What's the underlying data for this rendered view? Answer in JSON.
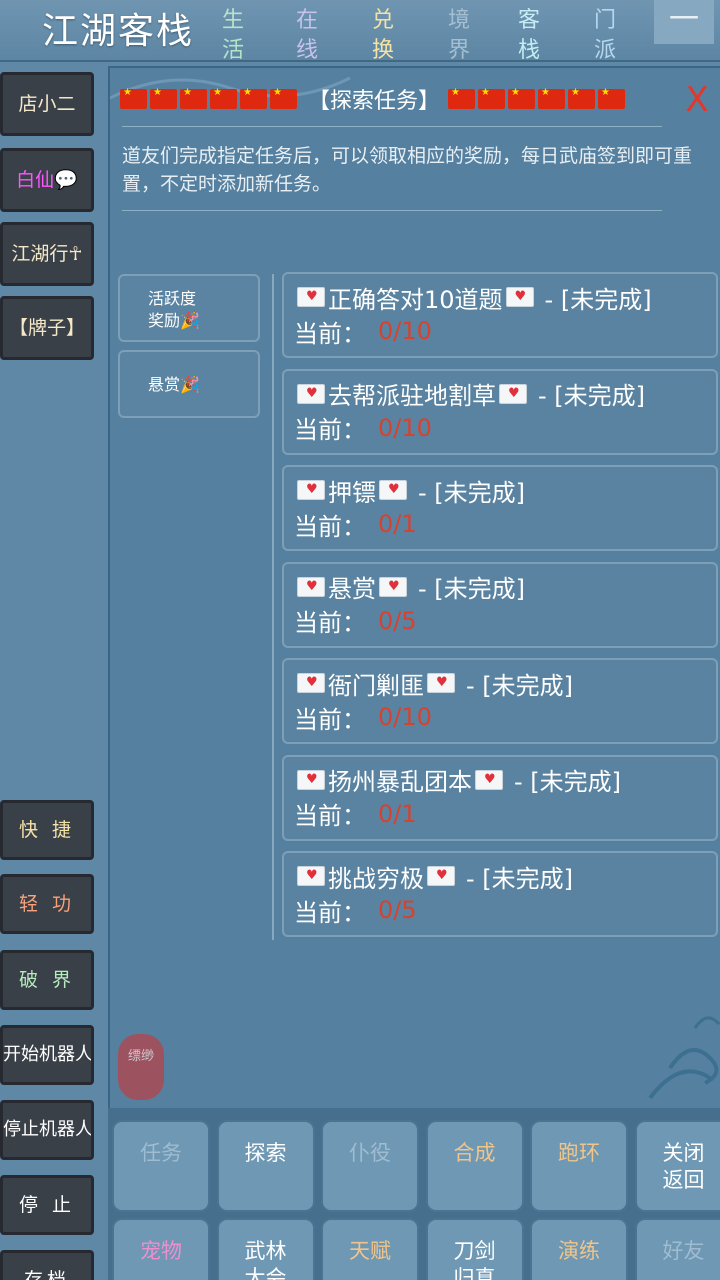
{
  "header": {
    "title": "江湖客栈",
    "nav": [
      {
        "label": "生活",
        "color": "#b7e3c9"
      },
      {
        "label": "在线",
        "color": "#c7c2ec"
      },
      {
        "label": "兑换",
        "color": "#f4e3a6"
      },
      {
        "label": "境界",
        "color": "#a6bfd0"
      },
      {
        "label": "客栈",
        "color": "#c4ecf2"
      },
      {
        "label": "门派",
        "color": "#b5d8ef"
      }
    ],
    "minimize": "一"
  },
  "left": {
    "top_buttons": [
      {
        "label": "店小二",
        "color": "#f4e8c8"
      },
      {
        "label": "白仙💬",
        "color": "#ff55ff"
      },
      {
        "label": "江湖行☥",
        "color": "#f4e8c8"
      },
      {
        "label": "【牌子】",
        "color": "#f4e8c8"
      }
    ],
    "bottom_buttons": [
      {
        "label": "快 捷",
        "color": "#f4e3a6"
      },
      {
        "label": "轻 功",
        "color": "#f7a27a"
      },
      {
        "label": "破 界",
        "color": "#b7ecbc"
      },
      {
        "label": "开始机器人",
        "color": "#ffffff"
      },
      {
        "label": "停止机器人",
        "color": "#ffffff"
      },
      {
        "label": "停 止",
        "color": "#ffffff"
      },
      {
        "label": "存档",
        "color": "#ffffff"
      }
    ]
  },
  "panel": {
    "title": "【探索任务】",
    "flags_each_side": 6,
    "close": "X",
    "description": "道友们完成指定任务后，可以领取相应的奖励，每日武庙签到即可重置，不定时添加新任务。",
    "tabs": [
      {
        "line1": "活跃度",
        "line2": "奖励🎉"
      },
      {
        "line1": "悬赏🎉",
        "line2": ""
      }
    ],
    "progress_label": "当前：",
    "tasks": [
      {
        "name": "正确答对10道题",
        "status": "- [未完成]",
        "progress": "0/10"
      },
      {
        "name": "去帮派驻地割草",
        "status": "- [未完成]",
        "progress": "0/10"
      },
      {
        "name": "押镖",
        "status": "- [未完成]",
        "progress": "0/1"
      },
      {
        "name": "悬赏",
        "status": "- [未完成]",
        "progress": "0/5"
      },
      {
        "name": "衙门剿匪",
        "status": "- [未完成]",
        "progress": "0/10"
      },
      {
        "name": "扬州暴乱团本",
        "status": "- [未完成]",
        "progress": "0/1"
      },
      {
        "name": "挑战穷极",
        "status": "- [未完成]",
        "progress": "0/5"
      }
    ],
    "seal": "缥缈"
  },
  "grid": [
    {
      "label": "任务",
      "style": "dim"
    },
    {
      "label": "探索",
      "style": ""
    },
    {
      "label": "仆役",
      "style": "dim"
    },
    {
      "label": "合成",
      "style": "orange"
    },
    {
      "label": "跑环",
      "style": "orange"
    },
    {
      "label": "关闭返回",
      "style": ""
    },
    {
      "label": "宠物",
      "style": "pink"
    },
    {
      "label": "武林大会",
      "style": ""
    },
    {
      "label": "天赋",
      "style": "orange"
    },
    {
      "label": "刀剑归真",
      "style": ""
    },
    {
      "label": "演练",
      "style": "orange"
    },
    {
      "label": "好友",
      "style": "dim"
    }
  ]
}
